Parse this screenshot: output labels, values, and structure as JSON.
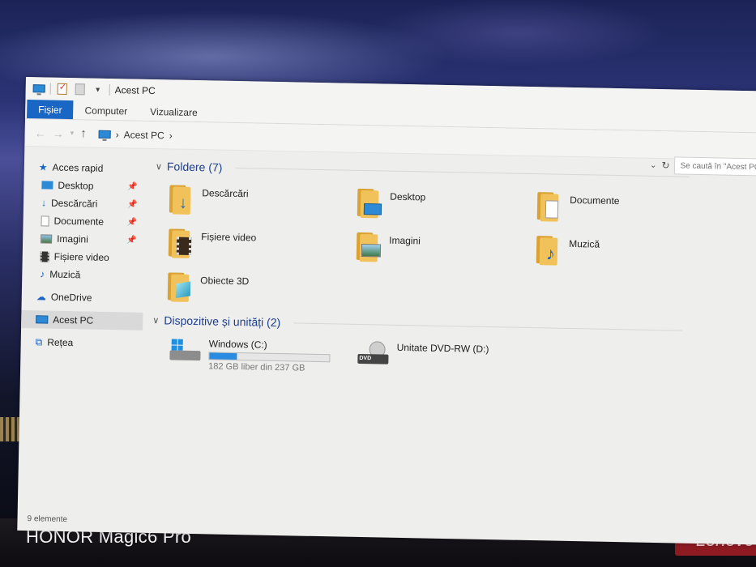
{
  "window": {
    "title": "Acest PC"
  },
  "ribbon": {
    "tabs": [
      "Fișier",
      "Computer",
      "Vizualizare"
    ]
  },
  "address": {
    "crumb": "Acest PC",
    "search_placeholder": "Se caută în \"Acest PC\""
  },
  "sidebar": {
    "items": [
      {
        "label": "Acces rapid"
      },
      {
        "label": "Desktop",
        "pinned": true
      },
      {
        "label": "Descărcări",
        "pinned": true
      },
      {
        "label": "Documente",
        "pinned": true
      },
      {
        "label": "Imagini",
        "pinned": true
      },
      {
        "label": "Fișiere video"
      },
      {
        "label": "Muzică"
      },
      {
        "label": "OneDrive"
      },
      {
        "label": "Acest PC",
        "selected": true
      },
      {
        "label": "Rețea"
      }
    ]
  },
  "folders": {
    "header": "Foldere (7)",
    "items": [
      {
        "label": "Descărcări",
        "icon": "download-arrow"
      },
      {
        "label": "Desktop",
        "icon": "desktop-screen"
      },
      {
        "label": "Documente",
        "icon": "document-page"
      },
      {
        "label": "Fișiere video",
        "icon": "film-strip"
      },
      {
        "label": "Imagini",
        "icon": "landscape-picture"
      },
      {
        "label": "Muzică",
        "icon": "music-note"
      },
      {
        "label": "Obiecte 3D",
        "icon": "cube"
      }
    ]
  },
  "devices": {
    "header": "Dispozitive și unități (2)",
    "items": [
      {
        "label": "Windows (C:)",
        "free": "182 GB liber din 237 GB",
        "used_fraction": 0.232
      },
      {
        "label": "Unitate DVD-RW (D:)",
        "tag": "DVD"
      }
    ]
  },
  "status": {
    "count": "9 elemente"
  },
  "photo": {
    "watermark": "HONOR Magic6 Pro",
    "brand": "Lenovo"
  },
  "colors": {
    "accent": "#1a66c4",
    "header_text": "#1e3f91",
    "drive_bar": "#2a8ce0",
    "folder": "#f2c25a"
  }
}
